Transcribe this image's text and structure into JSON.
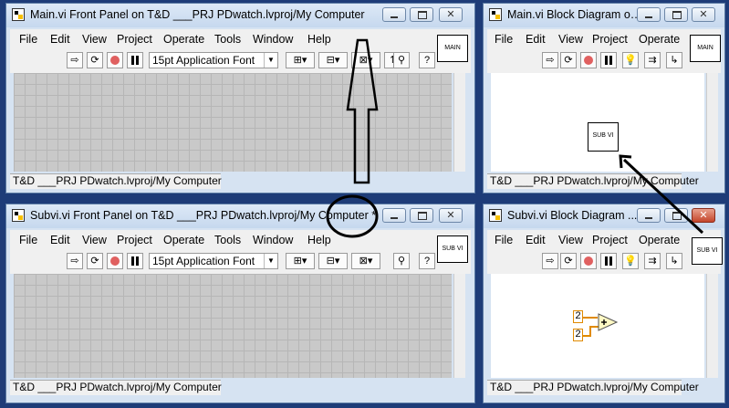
{
  "menu_labels": {
    "file": "File",
    "edit": "Edit",
    "view": "View",
    "project": "Project",
    "operate": "Operate",
    "tools": "Tools",
    "window": "Window",
    "help": "Help"
  },
  "font_selector": "15pt Application Font",
  "close_glyph": "✕",
  "windows": {
    "main_front": {
      "title": "Main.vi Front Panel on T&D ___PRJ PDwatch.lvproj/My Computer",
      "connector_label": "MAIN",
      "status": "T&D ___PRJ PDwatch.lvproj/My Computer"
    },
    "main_diagram": {
      "title": "Main.vi Block Diagram on T&D ___PRJ PDwatch.lvproj/M...",
      "connector_label": "MAIN",
      "subvi_label": "SUB VI",
      "status": "T&D ___PRJ PDwatch.lvproj/My Computer"
    },
    "subvi_front": {
      "title": "Subvi.vi Front Panel on T&D ___PRJ PDwatch.lvproj/My Computer *",
      "connector_label": "SUB VI",
      "status": "T&D ___PRJ PDwatch.lvproj/My Computer"
    },
    "subvi_diagram": {
      "title": "Subvi.vi Block Diagram ...",
      "connector_label": "SUB VI",
      "constant_a": "2",
      "constant_b": "2",
      "status": "T&D ___PRJ PDwatch.lvproj/My Computer"
    }
  },
  "colors": {
    "desktop": "#1e3c78",
    "wire_numeric": "#e08a00",
    "panel_grid": "#c9c9c9"
  }
}
